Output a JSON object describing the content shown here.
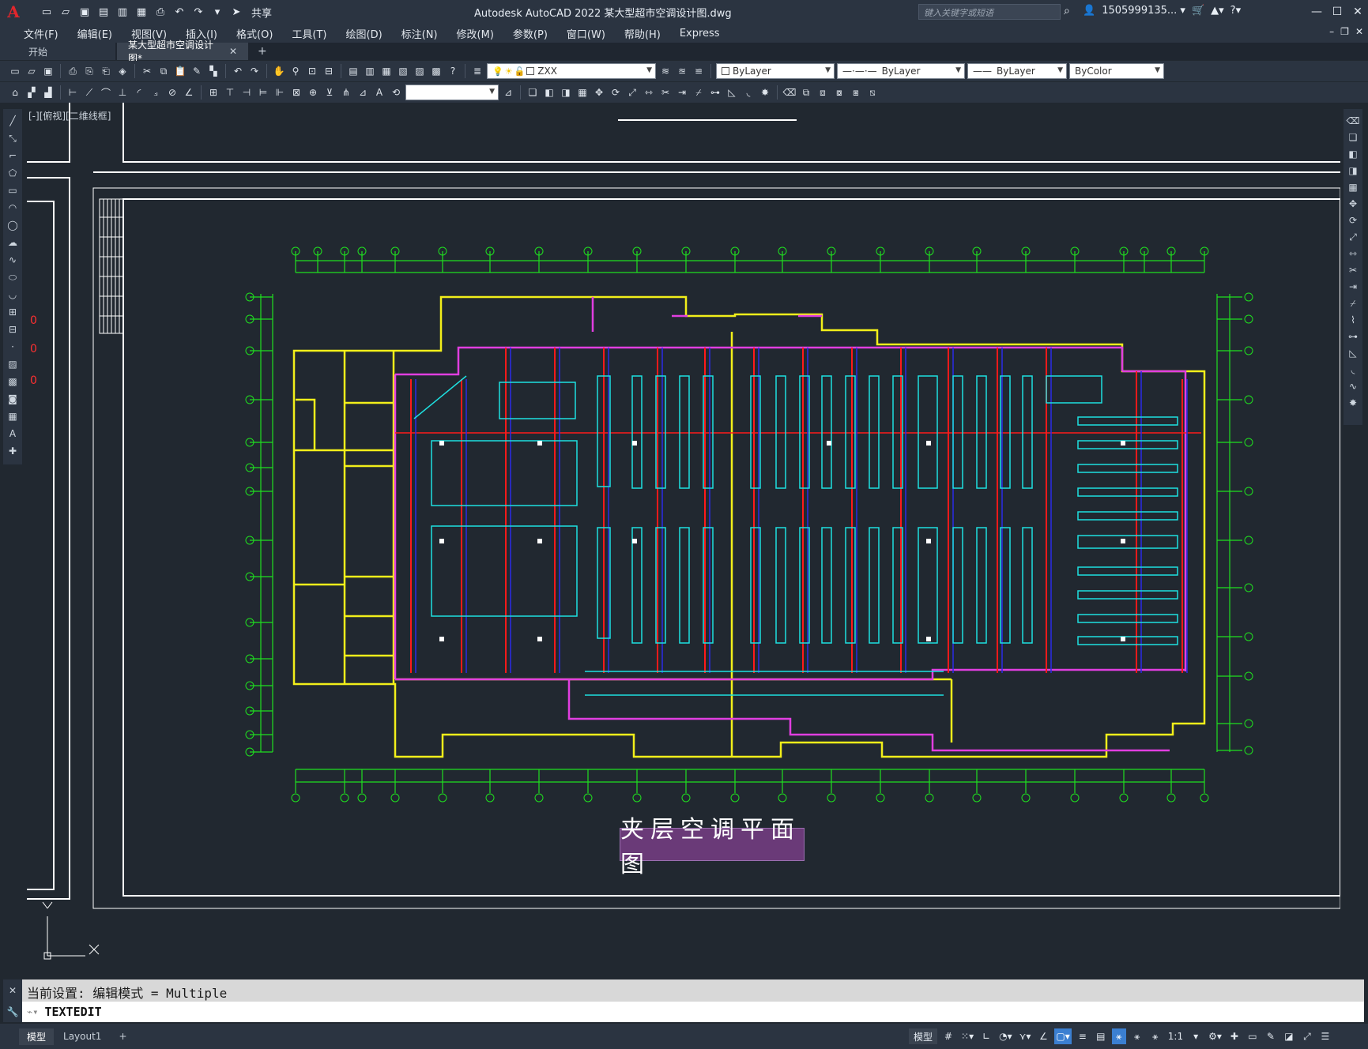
{
  "titlebar": {
    "app_logo": "A",
    "share_label": "共享",
    "title": "Autodesk AutoCAD 2022    某大型超市空调设计图.dwg",
    "search_placeholder": "键入关键字或短语",
    "user": "1505999135... ▾"
  },
  "menu": [
    "文件(F)",
    "编辑(E)",
    "视图(V)",
    "插入(I)",
    "格式(O)",
    "工具(T)",
    "绘图(D)",
    "标注(N)",
    "修改(M)",
    "参数(P)",
    "窗口(W)",
    "帮助(H)",
    "Express"
  ],
  "tabs": {
    "start": "开始",
    "active": "某大型超市空调设计图*",
    "add": "+"
  },
  "properties": {
    "layer": "ZXX",
    "color": "ByLayer",
    "linetype": "ByLayer",
    "lineweight": "ByLayer",
    "plotstyle": "ByColor"
  },
  "viewport": {
    "label": "[-][俯视][二维线框]",
    "drawing_title": "夹层空调平面图"
  },
  "command": {
    "history": "当前设置: 编辑模式 = Multiple",
    "current": "TEXTEDIT"
  },
  "status": {
    "model_tab": "模型",
    "layout_tab": "Layout1",
    "add": "+",
    "model_button": "模型",
    "scale": "1:1"
  },
  "colors": {
    "grid_green": "#1fe01f",
    "wall_yellow": "#f2ef1a",
    "duct_magenta": "#e13ee0",
    "pipe_red": "#ff1a1a",
    "shelf_cyan": "#1ee0e0",
    "frame_white": "#ffffff",
    "pipe_blue": "#2a2ae8"
  }
}
